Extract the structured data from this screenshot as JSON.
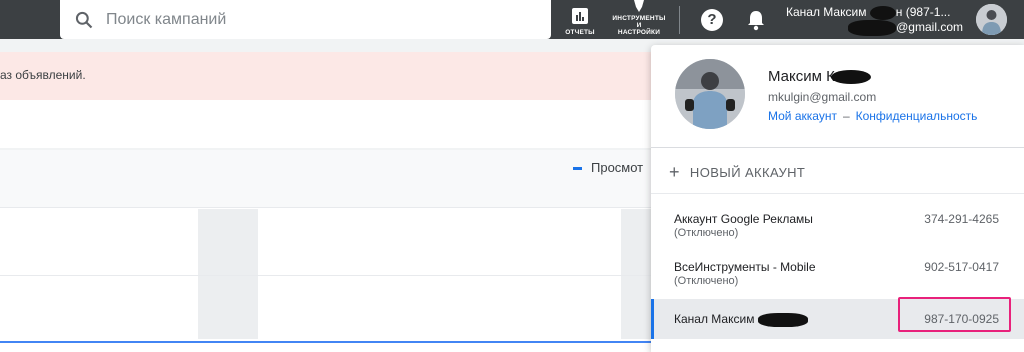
{
  "search": {
    "placeholder": "Поиск кампаний"
  },
  "toolbar": {
    "reports_label": "ОТЧЕТЫ",
    "tools_label_1": "ИНСТРУМЕНТЫ",
    "tools_label_2": "И",
    "tools_label_3": "НАСТРОЙКИ",
    "help_symbol": "?"
  },
  "header_account": {
    "line1_start": "Канал Максим",
    "line1_end": "н (987-1...",
    "line2_end": "@gmail.com"
  },
  "page": {
    "alert_text": "аз объявлений.",
    "legend_text": "Просмот"
  },
  "popup": {
    "name": "Максим К",
    "email": "mkulgin@gmail.com",
    "my_account_link": "Мой аккаунт",
    "link_separator": "–",
    "privacy_link": "Конфиденциальность",
    "new_account_label": "НОВЫЙ АККАУНТ",
    "accounts": [
      {
        "name": "Аккаунт Google Рекламы",
        "status": "(Отключено)",
        "id": "374-291-4265"
      },
      {
        "name": "ВсеИнструменты - Mobile",
        "status": "(Отключено)",
        "id": "902-517-0417"
      },
      {
        "name": "Канал Максим",
        "status": "",
        "id": "987-170-0925"
      }
    ]
  },
  "colors": {
    "topbar": "#3c4043",
    "accent": "#1a73e8",
    "highlight": "#e8217b",
    "alert_bg": "#fce8e6"
  }
}
